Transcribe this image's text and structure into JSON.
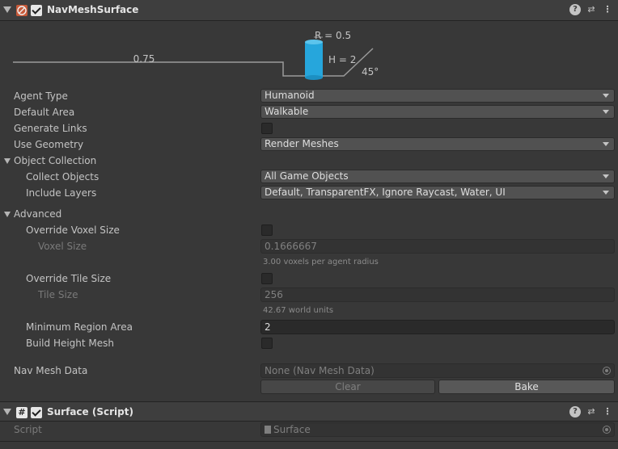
{
  "component": {
    "title": "NavMeshSurface",
    "enabled": true,
    "help_glyph": "?",
    "preset_glyph": "⇄",
    "menu_glyph": "⋮"
  },
  "diagram": {
    "step_label": "0.75",
    "radius_label": "R = 0.5",
    "height_label": "H = 2",
    "slope_label": "45°",
    "agent_color": "#26a6dc"
  },
  "fields": {
    "agent_type": {
      "label": "Agent Type",
      "value": "Humanoid"
    },
    "default_area": {
      "label": "Default Area",
      "value": "Walkable"
    },
    "generate_links": {
      "label": "Generate Links",
      "checked": false
    },
    "use_geometry": {
      "label": "Use Geometry",
      "value": "Render Meshes"
    }
  },
  "object_collection": {
    "label": "Object Collection",
    "collect_objects": {
      "label": "Collect Objects",
      "value": "All Game Objects"
    },
    "include_layers": {
      "label": "Include Layers",
      "value": "Default, TransparentFX, Ignore Raycast, Water, UI"
    }
  },
  "advanced": {
    "label": "Advanced",
    "override_voxel_size": {
      "label": "Override Voxel Size",
      "checked": false
    },
    "voxel_size": {
      "label": "Voxel Size",
      "value": "0.1666667",
      "hint": "3.00 voxels per agent radius"
    },
    "override_tile_size": {
      "label": "Override Tile Size",
      "checked": false
    },
    "tile_size": {
      "label": "Tile Size",
      "value": "256",
      "hint": "42.67 world units"
    },
    "min_region_area": {
      "label": "Minimum Region Area",
      "value": "2"
    },
    "build_height_mesh": {
      "label": "Build Height Mesh",
      "checked": false
    }
  },
  "nav_mesh_data": {
    "label": "Nav Mesh Data",
    "value": "None (Nav Mesh Data)"
  },
  "buttons": {
    "clear": "Clear",
    "bake": "Bake"
  },
  "script_component": {
    "title": "Surface (Script)",
    "enabled": true,
    "icon_glyph": "#",
    "script_label": "Script",
    "script_value": "Surface"
  },
  "colors": {
    "panel_bg": "#383838",
    "header_bg": "#3e3e3e",
    "accent_blue": "#26a6dc",
    "navmesh_icon": "#c75a3a"
  }
}
